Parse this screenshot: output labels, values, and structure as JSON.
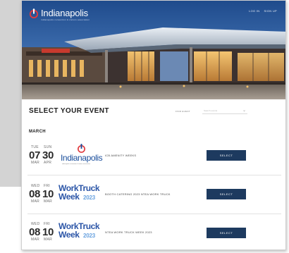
{
  "header": {
    "brand": "Indianapolis",
    "brand_tagline": "indianapolis convention & visitors association",
    "nav": [
      "LOG IN",
      "SIGN UP"
    ]
  },
  "events_section": {
    "title": "SELECT YOUR EVENT",
    "filter_label": "FIND EVENT",
    "filter_placeholder": "Search events",
    "month": "MARCH",
    "events": [
      {
        "dow_start": "TUE",
        "dow_end": "SUN",
        "day_start": "07",
        "day_end": "30",
        "mon_start": "MAR",
        "mon_end": "APR",
        "logo": "indianapolis-logo",
        "logo_word": "Indianapolis",
        "logo_sub": "indianapolis convention & visitors association",
        "name": "ICB AMENITY WEEKS",
        "button": "SELECT"
      },
      {
        "dow_start": "WED",
        "dow_end": "FRI",
        "day_start": "08",
        "day_end": "10",
        "mon_start": "MAR",
        "mon_end": "MAR",
        "logo": "work-truck-week-logo",
        "logo_line1": "WorkTruck",
        "logo_line2": "Week",
        "logo_year": "2023",
        "name": "BOOTH CATERING 2023 NTEA WORK TRUCK",
        "button": "SELECT"
      },
      {
        "dow_start": "WED",
        "dow_end": "FRI",
        "day_start": "08",
        "day_end": "10",
        "mon_start": "MAR",
        "mon_end": "MAR",
        "logo": "work-truck-week-logo",
        "logo_line1": "WorkTruck",
        "logo_line2": "Week",
        "logo_year": "2023",
        "name": "NTEA WORK TRUCK WEEK 2023",
        "button": "SELECT"
      }
    ]
  },
  "colors": {
    "button": "#1d3a5f",
    "brand_blue": "#1c4f9c",
    "brand_red": "#e03a3e",
    "work_truck_blue": "#2b55a7",
    "work_truck_light": "#6aa3e0"
  }
}
